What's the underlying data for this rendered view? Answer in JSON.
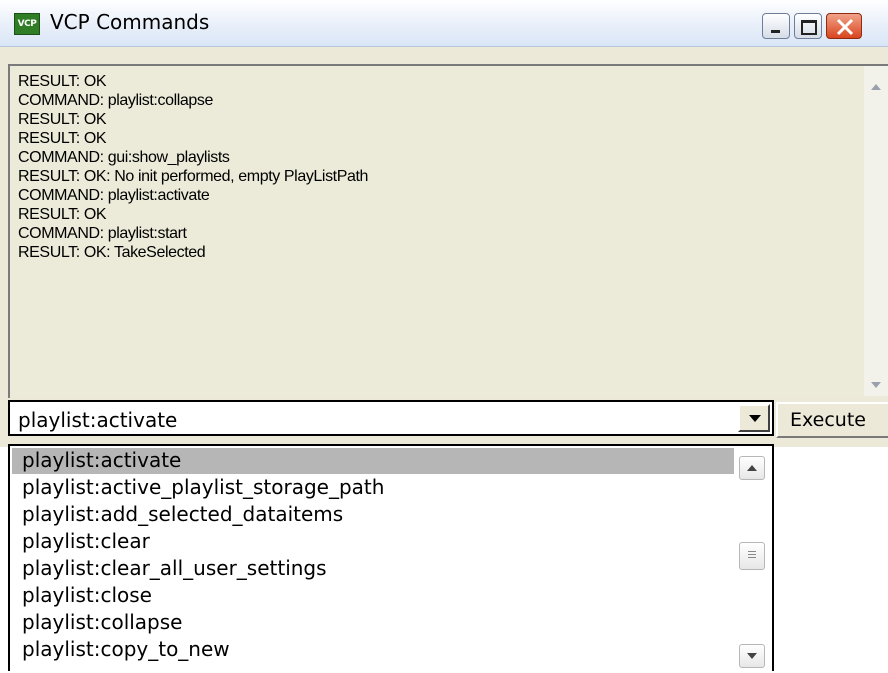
{
  "window": {
    "title": "VCP Commands",
    "icon": "vcp-app-icon",
    "icon_text": "VCP"
  },
  "output": {
    "lines": [
      "RESULT: OK",
      "COMMAND: playlist:collapse",
      "RESULT: OK",
      "RESULT: OK",
      "COMMAND: gui:show_playlists",
      "RESULT: OK: No init performed, empty PlayListPath",
      "COMMAND: playlist:activate",
      "RESULT: OK",
      "COMMAND: playlist:start",
      "RESULT: OK: TakeSelected"
    ]
  },
  "command": {
    "value": "playlist:activate",
    "execute_label": "Execute"
  },
  "dropdown": {
    "selected_index": 0,
    "items": [
      "playlist:activate",
      "playlist:active_playlist_storage_path",
      "playlist:add_selected_dataitems",
      "playlist:clear",
      "playlist:clear_all_user_settings",
      "playlist:close",
      "playlist:collapse",
      "playlist:copy_to_new"
    ]
  },
  "colors": {
    "panel_bg": "#ECE9D8",
    "selection_bg": "#B6B6B6",
    "close_button": "#D8451F"
  }
}
